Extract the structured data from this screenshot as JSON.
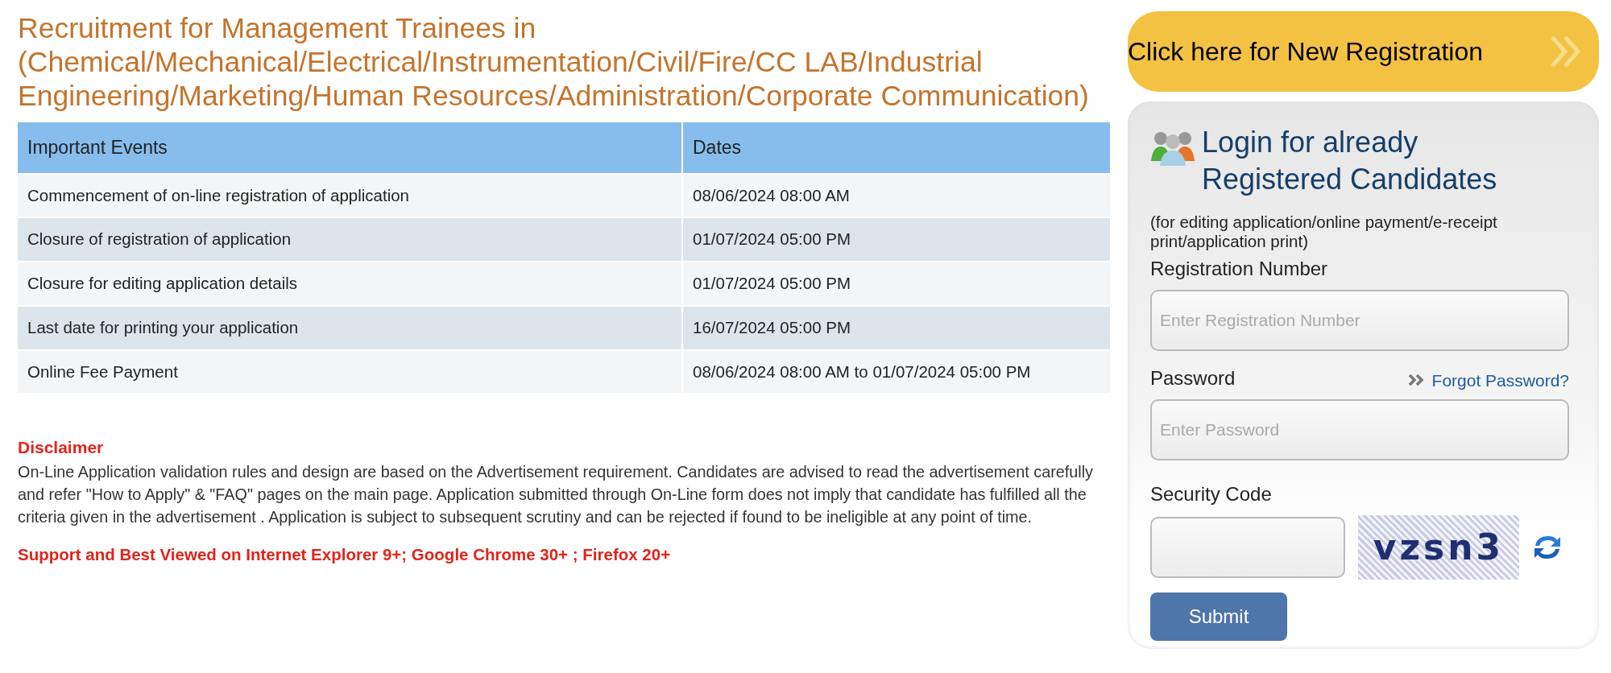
{
  "title": "Recruitment for Management Trainees in (Chemical/Mechanical/Electrical/Instrumentation/Civil/Fire/CC LAB/Industrial Engineering/Marketing/Human Resources/Administration/Corporate Communication)",
  "events_table": {
    "columns": [
      "Important Events",
      "Dates"
    ],
    "rows": [
      {
        "event": "Commencement of on-line registration of application",
        "date": "08/06/2024 08:00 AM"
      },
      {
        "event": "Closure of registration of application",
        "date": "01/07/2024 05:00 PM"
      },
      {
        "event": "Closure for editing application details",
        "date": "01/07/2024 05:00 PM"
      },
      {
        "event": "Last date for printing your application",
        "date": "16/07/2024 05:00 PM"
      },
      {
        "event": "Online Fee Payment",
        "date": "08/06/2024 08:00 AM to 01/07/2024 05:00 PM"
      }
    ]
  },
  "disclaimer": {
    "heading": "Disclaimer",
    "text": "On-Line Application validation rules and design are based on the Advertisement requirement. Candidates are advised to read the advertisement carefully and refer \"How to Apply\" & \"FAQ\" pages on the main page. Application submitted through On-Line form does not imply that candidate has fulfilled all the criteria given in the advertisement . Application is subject to subsequent scrutiny and can be rejected if found to be ineligible at any point of time."
  },
  "browser_note": "Support and Best Viewed on Internet Explorer 9+; Google Chrome 30+ ; Firefox 20+",
  "new_registration_button": "Click here for New Registration",
  "login": {
    "heading": "Login for already Registered Candidates",
    "subtitle": "(for editing application/online payment/e-receipt print/application print)",
    "registration_label": "Registration Number",
    "registration_placeholder": "Enter Registration Number",
    "password_label": "Password",
    "forgot_link": "Forgot Password?",
    "password_placeholder": "Enter Password",
    "security_label": "Security Code",
    "captcha": "vzsn3",
    "submit": "Submit"
  }
}
